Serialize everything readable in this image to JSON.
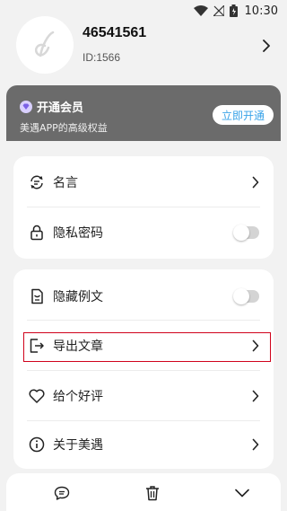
{
  "status_bar": {
    "time": "10:30",
    "icons": [
      "wifi-icon",
      "signal-off-icon",
      "battery-icon"
    ]
  },
  "profile": {
    "user_number": "46541561",
    "user_id": "ID:1566",
    "avatar_icon": "app-logo-icon"
  },
  "vip": {
    "title": "开通会员",
    "subtitle": "美遇APP的高级权益",
    "button_label": "立即开通",
    "icon": "diamond-icon",
    "accent_color": "#3aa3e8",
    "card_color": "#6b6b6b"
  },
  "menu_group_1": {
    "items": [
      {
        "label": "名言",
        "icon": "quote-refresh-icon",
        "control": "chevron"
      },
      {
        "label": "隐私密码",
        "icon": "lock-icon",
        "control": "toggle",
        "toggle_on": false
      }
    ]
  },
  "menu_group_2": {
    "items": [
      {
        "label": "隐藏例文",
        "icon": "hidden-doc-icon",
        "control": "toggle",
        "toggle_on": false
      },
      {
        "label": "导出文章",
        "icon": "export-icon",
        "control": "chevron"
      },
      {
        "label": "给个好评",
        "icon": "heart-icon",
        "control": "chevron"
      },
      {
        "label": "关于美遇",
        "icon": "info-icon",
        "control": "chevron"
      }
    ]
  },
  "highlight_color": "#d0021b",
  "bottom_bar": {
    "icons": [
      "comment-icon",
      "trash-icon",
      "chevron-down-icon"
    ]
  }
}
